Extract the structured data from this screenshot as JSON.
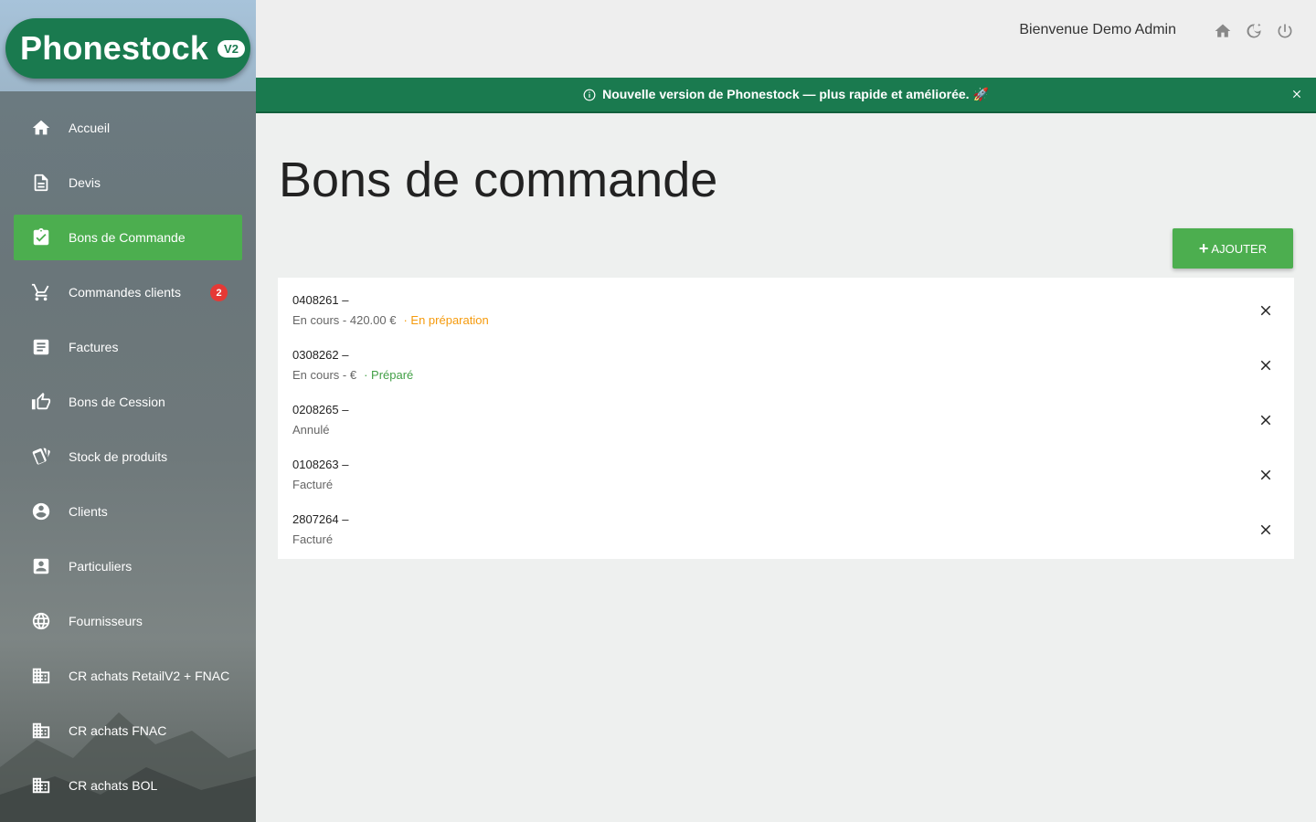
{
  "brand": {
    "name": "Phonestock",
    "version": "V2"
  },
  "nav": [
    {
      "label": "Accueil",
      "icon": "home-icon"
    },
    {
      "label": "Devis",
      "icon": "document-icon"
    },
    {
      "label": "Bons de Commande",
      "icon": "clipboard-check-icon",
      "active": true
    },
    {
      "label": "Commandes clients",
      "icon": "cart-icon",
      "badge": "2"
    },
    {
      "label": "Factures",
      "icon": "invoice-icon"
    },
    {
      "label": "Bons de Cession",
      "icon": "thumb-up-icon"
    },
    {
      "label": "Stock de produits",
      "icon": "cards-icon"
    },
    {
      "label": "Clients",
      "icon": "account-circle-icon"
    },
    {
      "label": "Particuliers",
      "icon": "account-box-icon"
    },
    {
      "label": "Fournisseurs",
      "icon": "globe-icon"
    },
    {
      "label": "CR achats RetailV2 + FNAC",
      "icon": "building-icon"
    },
    {
      "label": "CR achats FNAC",
      "icon": "building-icon"
    },
    {
      "label": "CR achats BOL",
      "icon": "building-icon"
    }
  ],
  "header": {
    "welcome": "Bienvenue Demo Admin"
  },
  "banner": {
    "text": "Nouvelle version de Phonestock — plus rapide et améliorée. 🚀"
  },
  "main": {
    "title": "Bons de commande",
    "add_label": "AJOUTER",
    "orders": [
      {
        "ref": "0408261 –",
        "status": "En cours - 420.00 €",
        "tag": "· En préparation",
        "tag_color": "#f59a0c"
      },
      {
        "ref": "0308262 –",
        "status": "En cours - €",
        "tag": "· Préparé",
        "tag_color": "#43a047"
      },
      {
        "ref": "0208265 –",
        "status": "Annulé",
        "tag": "",
        "tag_color": ""
      },
      {
        "ref": "0108263 –",
        "status": "Facturé",
        "tag": "",
        "tag_color": ""
      },
      {
        "ref": "2807264 –",
        "status": "Facturé",
        "tag": "",
        "tag_color": ""
      }
    ]
  },
  "colors": {
    "brand_green": "#1a7a4f",
    "accent_green": "#4cae4f",
    "badge_red": "#e53935"
  }
}
